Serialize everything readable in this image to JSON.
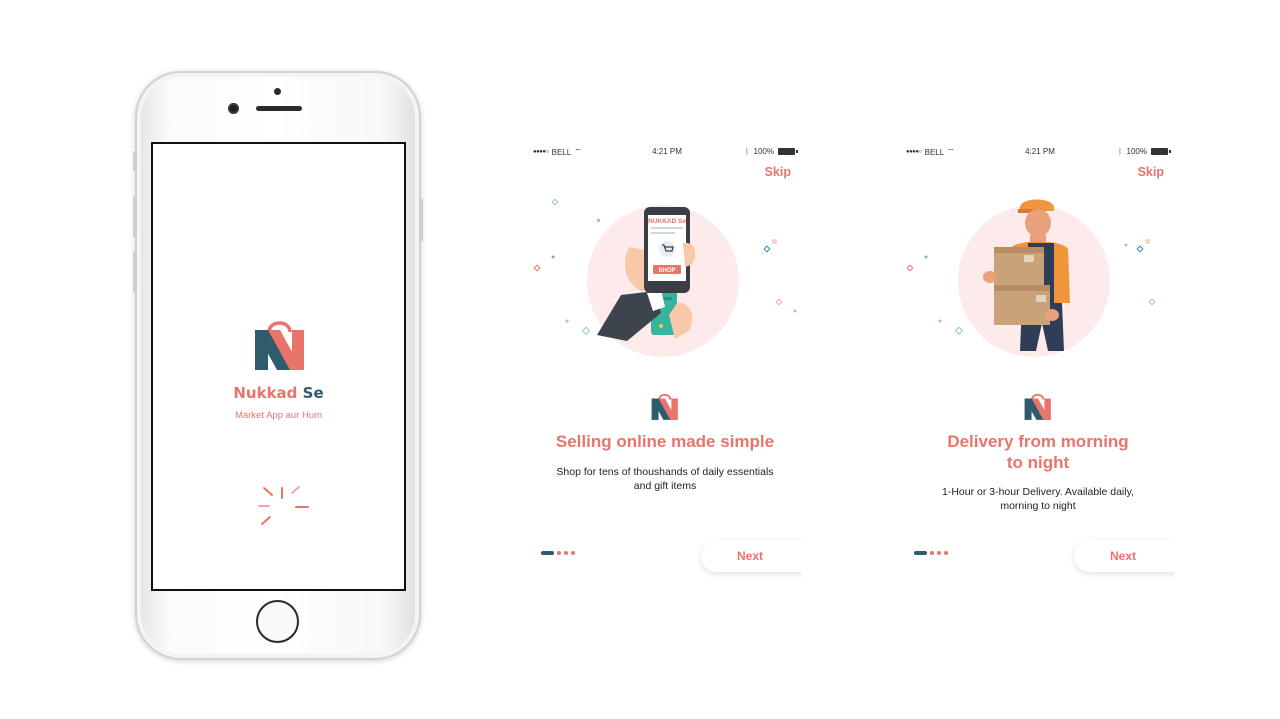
{
  "splash": {
    "brand_part1": "Nukkad ",
    "brand_part2": "Se",
    "tagline": "Market App aur Hum"
  },
  "screens": [
    {
      "status": {
        "carrier": "BELL",
        "time": "4:21 PM",
        "battery": "100%"
      },
      "skip_label": "Skip",
      "illustration_text": {
        "brand": "NUKKAD Se",
        "shop_button": "SHOP"
      },
      "title": "Selling online made simple",
      "description": "Shop for tens of thoushands of daily essentials and gift items",
      "next_label": "Next"
    },
    {
      "status": {
        "carrier": "BELL",
        "time": "4:21 PM",
        "battery": "100%"
      },
      "skip_label": "Skip",
      "title_line1": "Delivery from morning",
      "title_line2": "to night",
      "description": "1-Hour or 3-hour Delivery. Available daily, morning to night",
      "next_label": "Next"
    }
  ],
  "colors": {
    "accent": "#e9746b",
    "brand_dark": "#2e5c6c",
    "background": "#ffffff"
  },
  "icons": [
    "n-logo-icon",
    "spinner-icon",
    "wifi-icon",
    "bluetooth-icon",
    "battery-icon",
    "signal-icon"
  ]
}
